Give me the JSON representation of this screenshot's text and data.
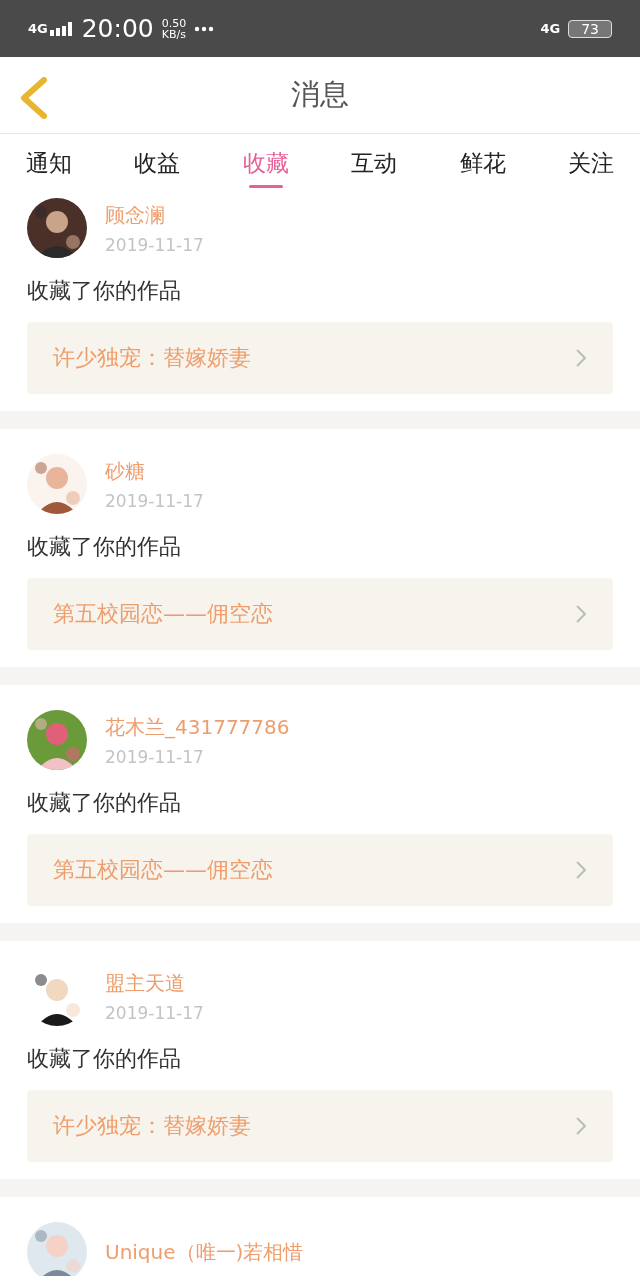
{
  "status_bar": {
    "network_left": "4G",
    "time": "20:00",
    "speed_value": "0.50",
    "speed_unit": "KB/s",
    "network_right": "4G",
    "battery": "73"
  },
  "header": {
    "title": "消息"
  },
  "tabs": [
    {
      "label": "通知",
      "selected": false
    },
    {
      "label": "收益",
      "selected": false
    },
    {
      "label": "收藏",
      "selected": true
    },
    {
      "label": "互动",
      "selected": false
    },
    {
      "label": "鲜花",
      "selected": false
    },
    {
      "label": "关注",
      "selected": false
    }
  ],
  "messages": [
    {
      "user": "顾念澜",
      "date": "2019-11-17",
      "action": "收藏了你的作品",
      "work": "许少独宠：替嫁娇妻"
    },
    {
      "user": "砂糖",
      "date": "2019-11-17",
      "action": "收藏了你的作品",
      "work": "第五校园恋——佣空恋"
    },
    {
      "user": "花木兰_431777786",
      "date": "2019-11-17",
      "action": "收藏了你的作品",
      "work": "第五校园恋——佣空恋"
    },
    {
      "user": "盟主天道",
      "date": "2019-11-17",
      "action": "收藏了你的作品",
      "work": "许少独宠：替嫁娇妻"
    },
    {
      "user": "Unique（唯一)若相惜"
    }
  ]
}
